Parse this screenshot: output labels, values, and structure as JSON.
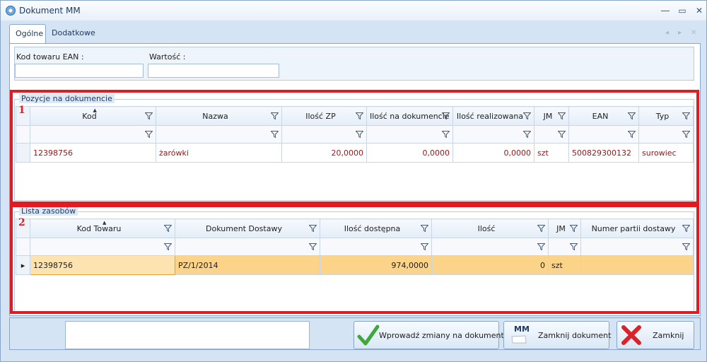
{
  "window": {
    "title": "Dokument MM"
  },
  "tabs": [
    {
      "label": "Ogólne"
    },
    {
      "label": "Dodatkowe"
    }
  ],
  "form": {
    "ean_label": "Kod towaru EAN :",
    "ean_value": "",
    "value_label": "Wartość :",
    "value_value": ""
  },
  "annotations": {
    "box1": "1",
    "box2": "2"
  },
  "positions": {
    "title": "Pozycje na dokumencie",
    "columns": [
      "Kod",
      "Nazwa",
      "Ilość ZP",
      "Ilość na dokumencie",
      "Ilość realizowana",
      "JM",
      "EAN",
      "Typ"
    ],
    "rows": [
      [
        "12398756",
        "żarówki",
        "20,0000",
        "0,0000",
        "0,0000",
        "szt",
        "500829300132",
        "surowiec"
      ]
    ]
  },
  "resources": {
    "title": "Lista zasobów",
    "columns": [
      "Kod Towaru",
      "Dokument Dostawy",
      "Ilość dostępna",
      "Ilość",
      "JM",
      "Numer partii dostawy"
    ],
    "rows": [
      [
        "12398756",
        "PZ/1/2014",
        "974,0000",
        "0",
        "szt",
        ""
      ]
    ]
  },
  "buttons": {
    "apply": "Wprowadź zmiany na dokument",
    "close_doc": "Zamknij dokument",
    "close_doc_icon_text": "MM",
    "close": "Zamknij"
  },
  "colors": {
    "highlight": "#e21b23",
    "selected_row": "#fbd48a",
    "data_text": "#8b1a1a"
  }
}
